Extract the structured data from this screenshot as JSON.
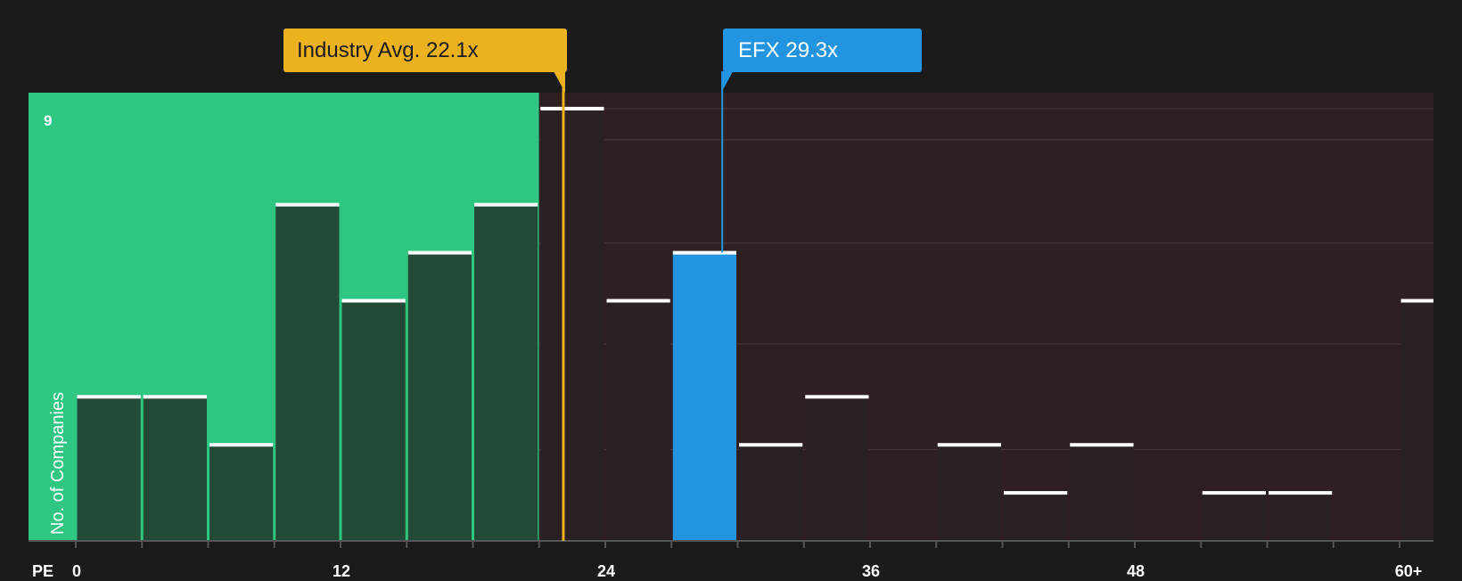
{
  "chart_data": {
    "type": "bar",
    "x_axis_title": "PE",
    "y_axis_title": "No. of Companies",
    "y_max_label": "9",
    "x_ticks": [
      "0",
      "12",
      "24",
      "36",
      "48",
      "60+"
    ],
    "x_tick_values": [
      0,
      12,
      24,
      36,
      48,
      60
    ],
    "ylim": [
      0,
      9
    ],
    "bin_width": 3,
    "bins": [
      {
        "start": 0,
        "count": 3
      },
      {
        "start": 3,
        "count": 3
      },
      {
        "start": 6,
        "count": 2
      },
      {
        "start": 9,
        "count": 7
      },
      {
        "start": 12,
        "count": 5
      },
      {
        "start": 15,
        "count": 6
      },
      {
        "start": 18,
        "count": 7
      },
      {
        "start": 21,
        "count": 9
      },
      {
        "start": 24,
        "count": 5
      },
      {
        "start": 27,
        "count": 6,
        "highlight": true
      },
      {
        "start": 30,
        "count": 2
      },
      {
        "start": 33,
        "count": 3
      },
      {
        "start": 36,
        "count": 0
      },
      {
        "start": 39,
        "count": 2
      },
      {
        "start": 42,
        "count": 1
      },
      {
        "start": 45,
        "count": 2
      },
      {
        "start": 48,
        "count": 0
      },
      {
        "start": 51,
        "count": 1
      },
      {
        "start": 54,
        "count": 1
      },
      {
        "start": 57,
        "count": 0
      },
      {
        "start": 60,
        "count": 5
      }
    ],
    "industry_avg": {
      "label": "Industry Avg. 22.1x",
      "value": 22.1
    },
    "company": {
      "label": "EFX 29.3x",
      "value": 29.3
    },
    "grid": true,
    "colors": {
      "background": "#1b1b1c",
      "below_avg_zone": "#2ec680",
      "above_avg_zone": "#2f1f20",
      "bar_in_green": "#234a37",
      "bar_in_red": "#2a2222",
      "company_bar": "#2394e0",
      "industry_marker": "#ebb11e",
      "bar_cap": "#ffffff"
    }
  }
}
